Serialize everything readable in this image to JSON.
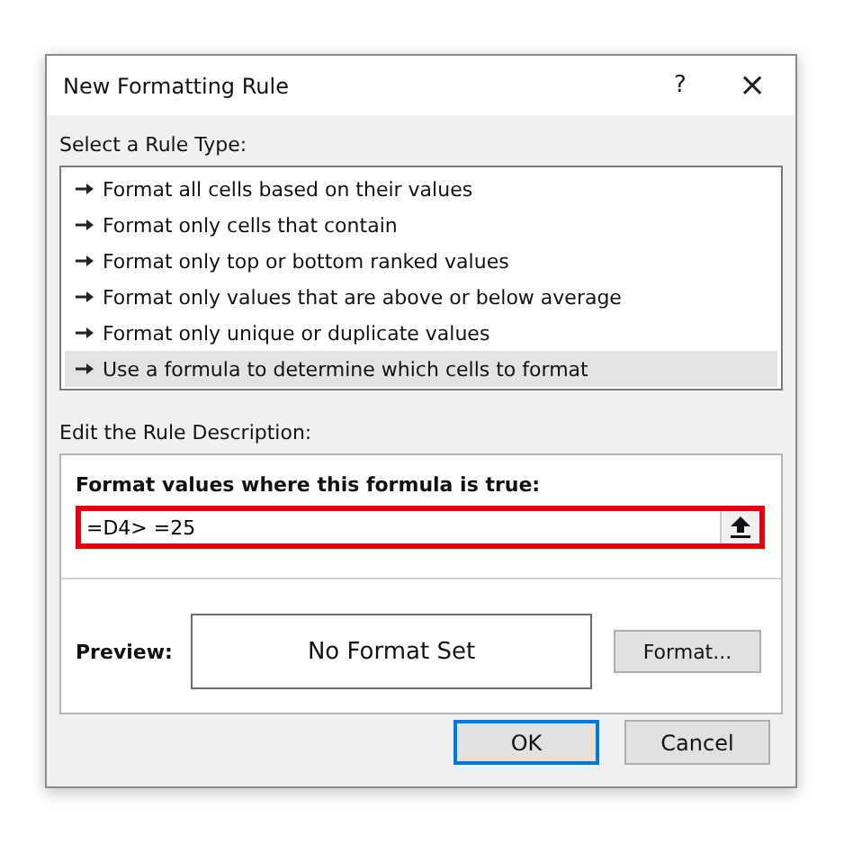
{
  "window": {
    "title": "New Formatting Rule",
    "help": "?",
    "close": "×"
  },
  "rule_type": {
    "label": "Select a Rule Type:",
    "items": [
      {
        "label": "Format all cells based on their values",
        "selected": false
      },
      {
        "label": "Format only cells that contain",
        "selected": false
      },
      {
        "label": "Format only top or bottom ranked values",
        "selected": false
      },
      {
        "label": "Format only values that are above or below average",
        "selected": false
      },
      {
        "label": "Format only unique or duplicate values",
        "selected": false
      },
      {
        "label": "Use a formula to determine which cells to format",
        "selected": true
      }
    ]
  },
  "description": {
    "label": "Edit the Rule Description:",
    "formula_label": "Format values where this formula is true:",
    "formula": "=D4> =25",
    "formula_highlighted": true,
    "preview_label": "Preview:",
    "preview": "No Format Set",
    "format_button": "Format..."
  },
  "buttons": [
    {
      "label": "OK",
      "default": true
    },
    {
      "label": "Cancel",
      "default": false
    }
  ]
}
